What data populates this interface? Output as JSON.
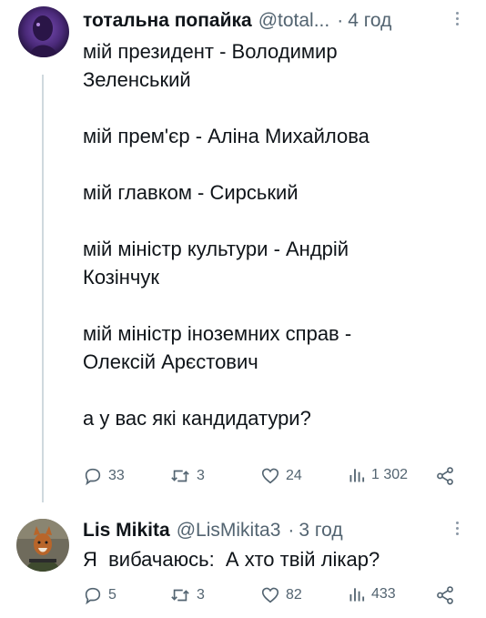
{
  "tweet1": {
    "name": "тотальна попайка",
    "handle": "@total...",
    "separator": "·",
    "time": "4 год",
    "text": "мій президент - Володимир\nЗеленський\n\nмій прем'єр - Аліна Михайлова\n\nмій главком - Сирський\n\nмій міністр культури - Андрій\nКозінчук\n\nмій міністр іноземних справ -\nОлексій Арєстович\n\nа у вас які кандидатури?",
    "replies": "33",
    "retweets": "3",
    "likes": "24",
    "views": "1 302"
  },
  "tweet2": {
    "name": "Lis Mikita",
    "handle": "@LisMikita3",
    "separator": "·",
    "time": "3 год",
    "text": "Я  вибачаюсь:  А хто твій лікар?",
    "replies": "5",
    "retweets": "3",
    "likes": "82",
    "views": "433"
  },
  "icons": {
    "reply": "speech-bubble-icon",
    "retweet": "retweet-icon",
    "like": "heart-icon",
    "views": "bar-chart-icon",
    "share": "share-icon",
    "more": "more-dots-icon"
  },
  "colors": {
    "text": "#0f1419",
    "secondary": "#536471",
    "avatar1": "#4b2a7a",
    "thread_line": "#cfd9de"
  }
}
